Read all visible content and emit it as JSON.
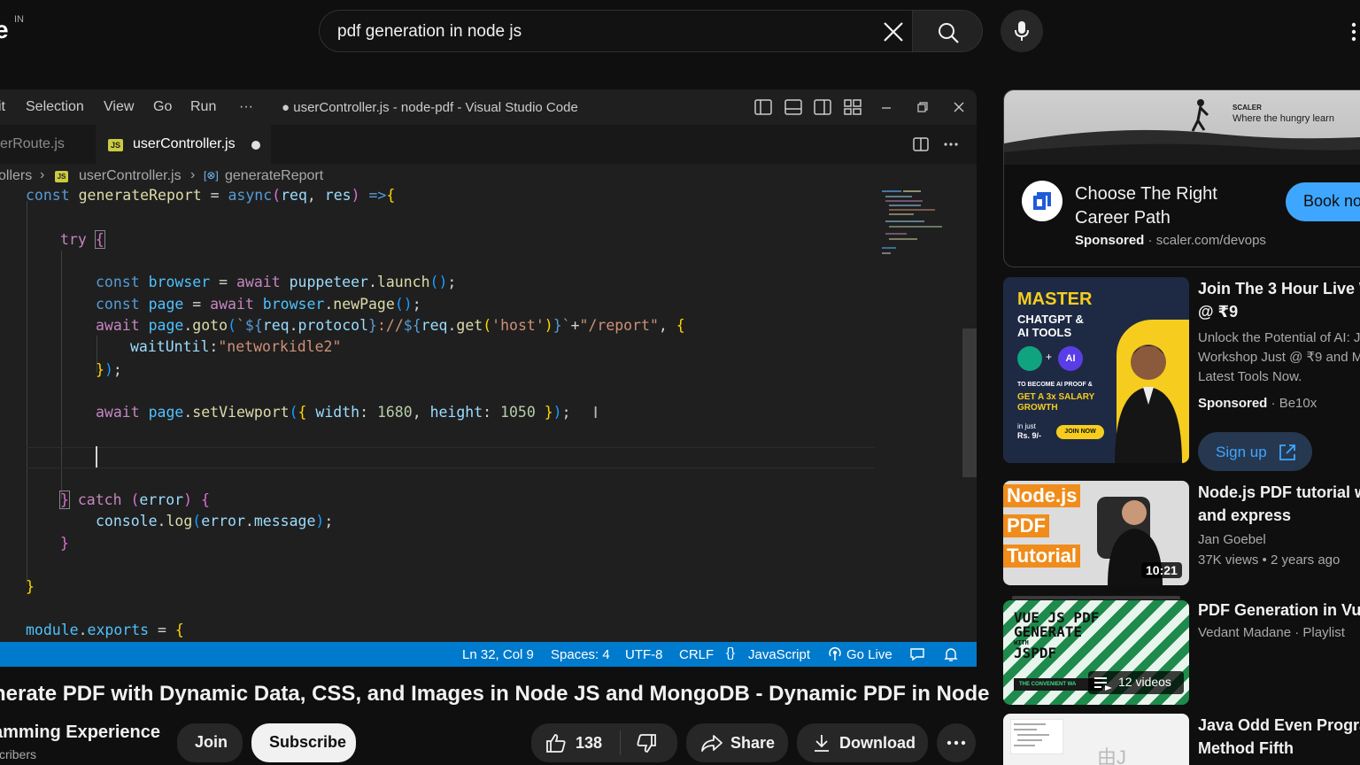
{
  "header": {
    "logo_letter": "e",
    "country_code": "IN",
    "search_value": "pdf generation in node js"
  },
  "vscode": {
    "menu": [
      "it",
      "Selection",
      "View",
      "Go",
      "Run",
      "···"
    ],
    "window_title": "● userController.js - node-pdf - Visual Studio Code",
    "tabs": {
      "inactive": "erRoute.js",
      "active": "userController.js",
      "active_badge": "JS"
    },
    "breadcrumb": {
      "folder": "ollers",
      "file": "userController.js",
      "symbol": "generateReport",
      "file_badge": "JS",
      "symbol_icon": "[⊗]"
    },
    "status": {
      "position": "Ln 32, Col 9",
      "spaces": "Spaces: 4",
      "encoding": "UTF-8",
      "eol": "CRLF",
      "language_icon": "{}",
      "language": "JavaScript",
      "go_live": "Go Live"
    }
  },
  "video": {
    "title": "nerate PDF with Dynamic Data, CSS, and Images in Node JS and MongoDB - Dynamic PDF in Node",
    "channel": "amming Experience",
    "subscribers": "scribers",
    "join_label": "Join",
    "subscribe_label": "Subscribe",
    "likes": "138",
    "share_label": "Share",
    "download_label": "Download"
  },
  "ad": {
    "banner_brand": "SCALER",
    "banner_tagline": "Where the hungry learn",
    "title_line1": "Choose The Right",
    "title_line2": "Career Path",
    "sponsored": "Sponsored",
    "url": "scaler.com/devops",
    "cta": "Book no"
  },
  "recommendations": [
    {
      "title_line1": "Join The 3 Hour Live W",
      "title_line2": "@ ₹9",
      "desc_line1": "Unlock the Potential of AI: J",
      "desc_line2": "Workshop Just @ ₹9 and M",
      "desc_line3": "Latest Tools Now.",
      "sponsored": "Sponsored",
      "advertiser": "Be10x",
      "cta": "Sign up",
      "thumb": {
        "heading": "MASTER",
        "sub1": "CHATGPT &",
        "sub2": "AI TOOLS",
        "plus": "+",
        "ai_badge": "AI",
        "line1": "TO BECOME AI PROOF &",
        "line2": "GET A 3x SALARY",
        "line3": "GROWTH",
        "price_label": "in just",
        "price": "Rs. 9/-",
        "join_now": "JOIN NOW"
      }
    },
    {
      "title_line1": "Node.js PDF tutorial wit",
      "title_line2": "and express",
      "channel": "Jan Goebel",
      "views": "37K views",
      "age": "2 years ago",
      "duration": "10:21",
      "thumb_words": [
        "Node.js",
        "PDF",
        "Tutorial"
      ]
    },
    {
      "title_line1": "PDF Generation in Vue.j",
      "meta": "Vedant Madane · Playlist",
      "count": "12 videos",
      "thumb_lines": [
        "VUE JS PDF",
        "GENERATE",
        "WITH",
        "JSPDF",
        "THE CONVENIENT WA"
      ]
    },
    {
      "title_line1": "Java Odd Even Program",
      "title_line2": "Method Fifth",
      "thumb_text": "由J"
    }
  ]
}
